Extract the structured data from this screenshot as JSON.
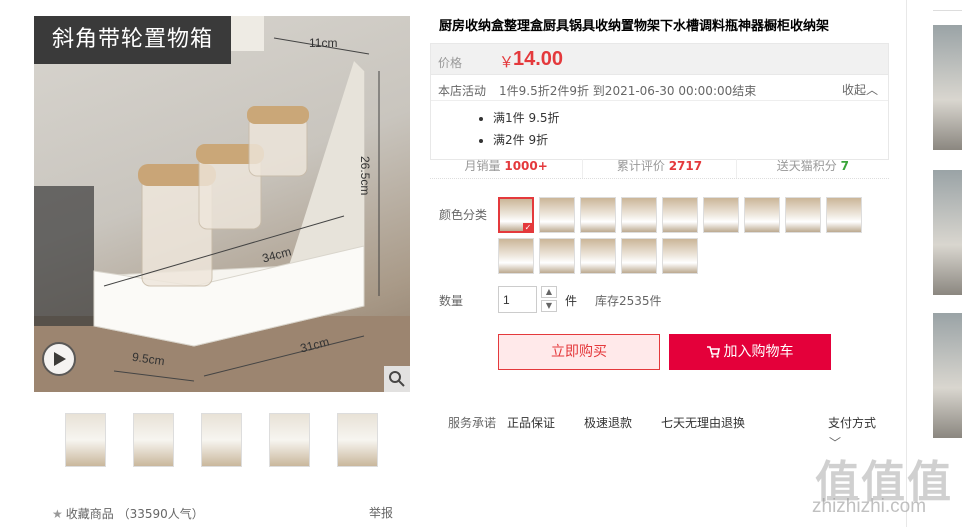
{
  "gallery": {
    "badge": "斜角带轮置物箱",
    "dimensions": [
      "11cm",
      "26.5cm",
      "34cm",
      "31cm",
      "9.5cm"
    ],
    "thumb_count": 5
  },
  "favorites": {
    "label": "收藏商品",
    "count": "（33590人气）"
  },
  "report": "举报",
  "product": {
    "title": "厨房收纳盒整理盒厨具锅具收纳置物架下水槽调料瓶神器橱柜收纳架",
    "price_label": "价格",
    "currency": "￥",
    "price": "14.00",
    "promo_label": "本店活动",
    "promo_text": "1件9.5折2件9折 到2021-06-30 00:00:00结束",
    "promo_fold": "收起",
    "promo_items": [
      "满1件 9.5折",
      "满2件 9折"
    ],
    "stats": [
      {
        "label": "月销量",
        "value": "1000+"
      },
      {
        "label": "累计评价",
        "value": "2717"
      },
      {
        "label": "送天猫积分",
        "value": "7"
      }
    ],
    "color_label": "颜色分类",
    "color_swatch_count": 14,
    "qty_label": "数量",
    "qty_value": "1",
    "qty_unit": "件",
    "stock": "库存2535件",
    "buy_now": "立即购买",
    "add_cart": "加入购物车",
    "service_label": "服务承诺",
    "services": [
      "正品保证",
      "极速退款",
      "七天无理由退换"
    ],
    "payment": "支付方式"
  },
  "watermark": {
    "logo": "值值值",
    "url": "zhizhizhi.com"
  },
  "colors": {
    "accent": "#e4393c",
    "cart": "#e4003a",
    "points": "#3aa53a"
  }
}
